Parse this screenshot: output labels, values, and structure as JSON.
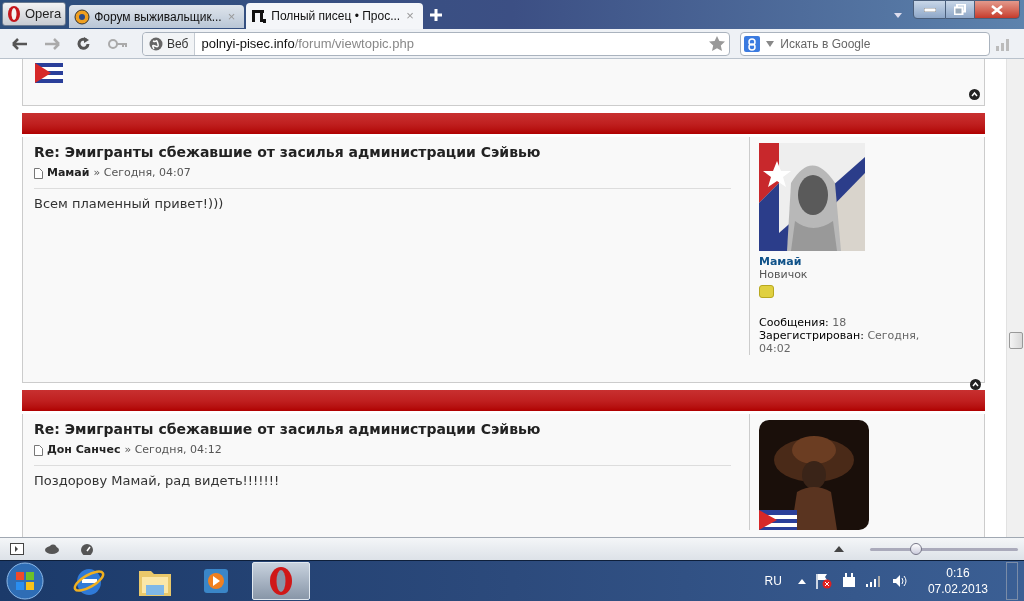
{
  "browser": {
    "tabs": [
      {
        "label": "Opera",
        "kind": "menu"
      },
      {
        "label": "Форум выживальщик...",
        "kind": "page",
        "close": "×",
        "selected": false
      },
      {
        "label": "Полный писец • Прос...",
        "kind": "page",
        "close": "×",
        "selected": true
      }
    ],
    "address": {
      "label": "Веб",
      "domain": "polnyi-pisec.info",
      "path": "/forum/viewtopic.php"
    },
    "search": {
      "placeholder": "Искать в Google"
    }
  },
  "posts": [
    {
      "title": "Re: Эмигранты сбежавшие от засилья администрации Сэйвью",
      "author": "Мамай",
      "date": "» Сегодня, 04:07",
      "body": "Всем пламенный привет!)))",
      "profile": {
        "name": "Мамай",
        "rank": "Новичок",
        "fields": [
          {
            "label": "Сообщения:",
            "value": "18"
          },
          {
            "label": "Зарегистрирован:",
            "value": "Сегодня, 04:02"
          }
        ]
      }
    },
    {
      "title": "Re: Эмигранты сбежавшие от засилья администрации Сэйвью",
      "author": "Дон Санчес",
      "date": "» Сегодня, 04:12",
      "body": "Поздорову Мамай, рад видеть!!!!!!!"
    }
  ],
  "status_bar": {
    "zoom": {
      "level": 0.31
    }
  },
  "taskbar": {
    "language": "RU",
    "time": "0:16",
    "date": "07.02.2013"
  }
}
